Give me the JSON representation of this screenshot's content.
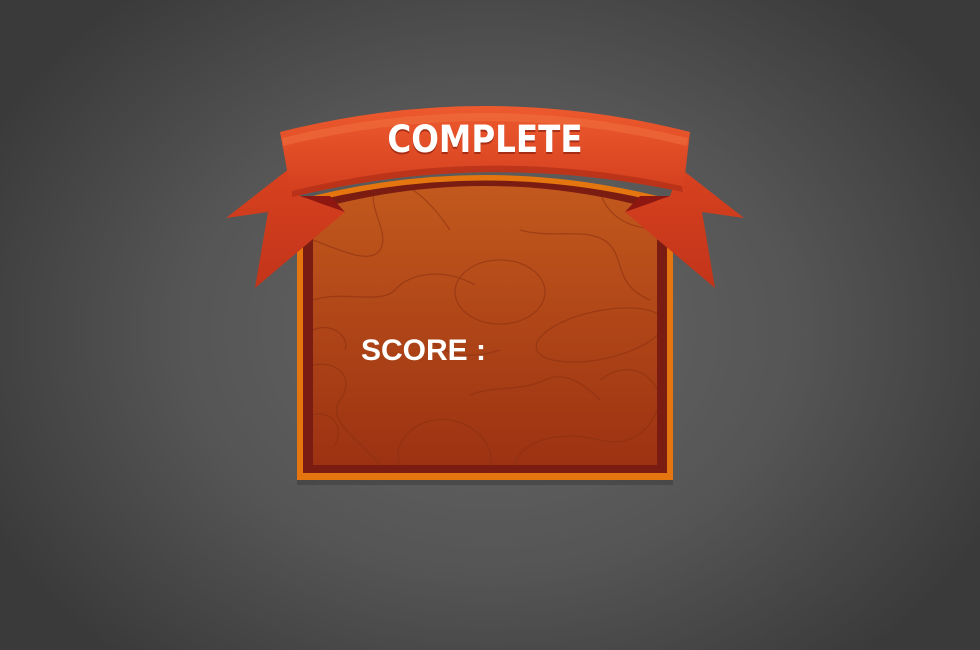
{
  "dialog": {
    "title": "COMPLETE",
    "score_label": "SCORE :"
  },
  "colors": {
    "background": "#555555",
    "ribbon": "#e04a24",
    "ribbon_dark": "#a81e1a",
    "board_wood": "#b54b1a",
    "board_frame": "#e5760f",
    "board_inner_border": "#7a1c12",
    "text": "#ffffff"
  }
}
